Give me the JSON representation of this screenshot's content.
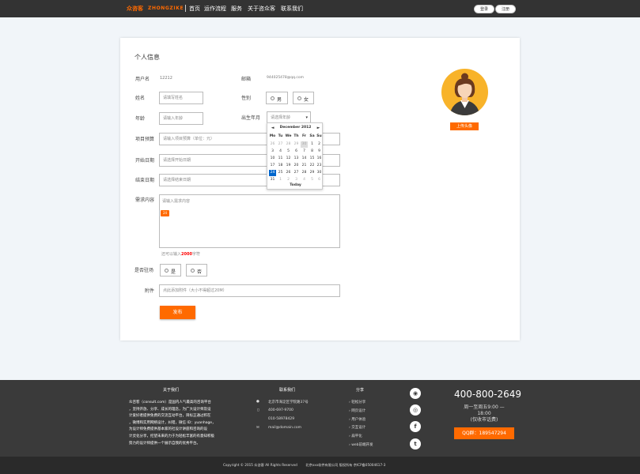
{
  "header": {
    "logo_cn": "众咨客",
    "logo_en": "ZHONGZIKE",
    "nav": [
      "首页",
      "运作流程",
      "服务",
      "关于咨众客",
      "联系我们"
    ],
    "login": "登录",
    "register": "注册"
  },
  "form": {
    "title": "个人信息",
    "username_label": "用户名",
    "username_value": "12212",
    "email_label": "邮箱",
    "email_value": "944025478@qq.com",
    "name_label": "姓名",
    "name_placeholder": "请填写姓名",
    "gender_label": "性别",
    "gender_male": "男",
    "gender_female": "女",
    "age_label": "年龄",
    "age_placeholder": "请输入年龄",
    "birth_label": "出生年月",
    "birth_placeholder": "请选择年龄",
    "budget_label": "项目预算",
    "budget_placeholder": "请输入项目预算（单位：元）",
    "start_label": "开始日期",
    "start_placeholder": "请选择开始日期",
    "end_label": "结束日期",
    "end_placeholder": "请选择结束日期",
    "req_label": "需求内容",
    "req_placeholder": "请输入需求内容",
    "req_tag": "24",
    "count_prefix": "还可以输入",
    "count_num": "2000",
    "count_suffix": "字符",
    "resident_label": "是否驻场",
    "yes": "是",
    "no": "否",
    "attach_label": "附件",
    "attach_placeholder": "点此添加附件（大小不得超过20M）",
    "publish": "发布",
    "upload_avatar": "上传头像"
  },
  "datepicker": {
    "title": "December 2012",
    "prev": "◄",
    "next": "►",
    "weekdays": [
      "Mo",
      "Tu",
      "We",
      "Th",
      "Fr",
      "Sa",
      "Su"
    ],
    "weeks": [
      [
        "26",
        "27",
        "28",
        "29",
        "30",
        "1",
        "2"
      ],
      [
        "3",
        "4",
        "5",
        "6",
        "7",
        "8",
        "9"
      ],
      [
        "10",
        "11",
        "12",
        "13",
        "14",
        "15",
        "16"
      ],
      [
        "17",
        "18",
        "19",
        "20",
        "21",
        "22",
        "23"
      ],
      [
        "24",
        "25",
        "26",
        "27",
        "28",
        "29",
        "30"
      ],
      [
        "31",
        "1",
        "2",
        "3",
        "4",
        "5",
        "6"
      ]
    ],
    "selected": "24",
    "today": "Today"
  },
  "footer": {
    "about_title": "关于我们",
    "about_lines": [
      "众咨客（consult.com）是国内人气最高的咨询平台",
      "，坚持开放、分享、成长的理念，为广大设计师及设",
      "计爱好者提供免费的交流互动平台，目标正通过积在",
      "，微博和实用网络设计，纠错，微信 ID：yuanhage，",
      "为设计师免费提供基本家的社设计讲座和咨询的设",
      "计灵化分享，挖望未来的力于为轻松丰富的有意知积极",
      "努力的设计师提供一个展示自我的优秀平台。"
    ],
    "contact_title": "联系我们",
    "contact_address": "北京市海淀区学院路37号",
    "contact_mobile": "400-697-9700",
    "contact_phone": "010-58978429",
    "contact_email": "mail@domain.com",
    "share_title": "分享",
    "share_items": [
      "轻松分享",
      "网页设计",
      "用户体验",
      "交互设计",
      "扁平化",
      "web前端开发"
    ],
    "social_icons": [
      "wechat-icon",
      "weibo-icon",
      "facebook-icon",
      "twitter-icon"
    ],
    "phone": "400-800-2649",
    "hours_line1": "周一至周五9:00 — 18:00",
    "hours_line2": "(仅收市话费)",
    "qq": "QQ群：189547294",
    "copyright": "Copyright © 2015 众咨客 All Rights Reserved        北京xxx软件有限公司 版权所有 京ICP备05004617-3"
  },
  "colors": {
    "accent": "#ff6a00",
    "topbar": "#333333",
    "footer": "#3a3a3a",
    "background": "#f1f5f9"
  }
}
